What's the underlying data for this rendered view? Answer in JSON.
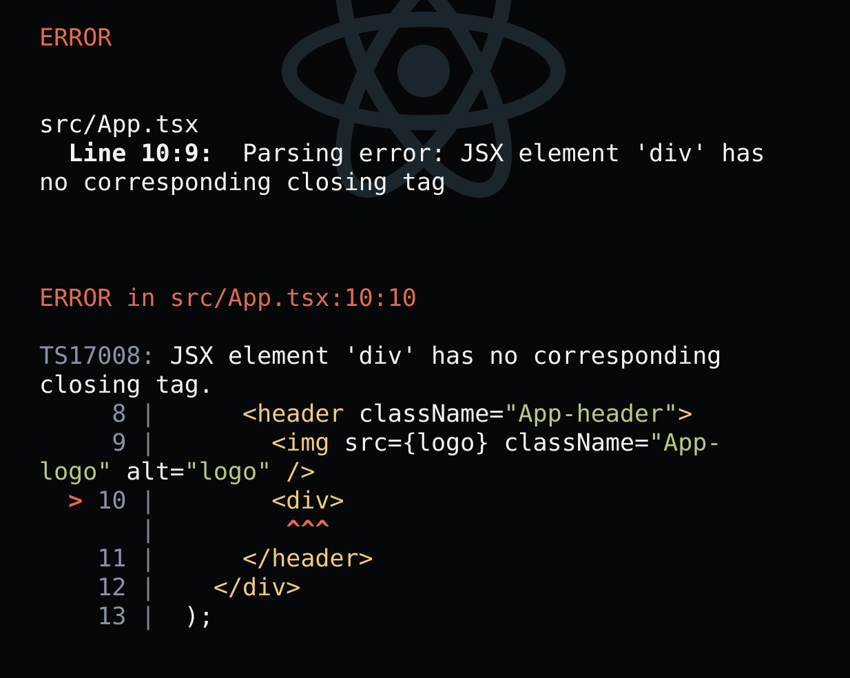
{
  "error_title": "ERROR",
  "file_path": "src/App.tsx",
  "lint": {
    "location": "Line 10:9:",
    "message": "Parsing error: JSX element 'div' has",
    "message_cont": "no corresponding closing tag"
  },
  "ts_error": {
    "header": "ERROR in src/App.tsx:10:10",
    "code": "TS17008:",
    "message": "JSX element 'div' has no corresponding",
    "message_cont": "closing tag."
  },
  "code_frame": {
    "lines": [
      {
        "num": "8",
        "marker": "",
        "indent": "      ",
        "tag_open": "<header",
        "attr": " className=",
        "str": "\"App-header\"",
        "tag_close": ">"
      },
      {
        "num": "9",
        "marker": "",
        "indent": "        ",
        "tag_open": "<img",
        "attr": " src={logo} className=",
        "str": "\"App-",
        "tag_close": ""
      },
      {
        "wrap_str": "logo\"",
        "wrap_attr": " alt=",
        "wrap_str2": "\"logo\"",
        "wrap_close": " />"
      },
      {
        "num": "10",
        "marker": ">",
        "indent": "        ",
        "tag_open": "<div>",
        "attr": "",
        "str": "",
        "tag_close": ""
      },
      {
        "caret": "^^^"
      },
      {
        "num": "11",
        "marker": "",
        "indent": "      ",
        "tag_open": "</header>",
        "attr": "",
        "str": "",
        "tag_close": ""
      },
      {
        "num": "12",
        "marker": "",
        "indent": "    ",
        "tag_open": "</div>",
        "attr": "",
        "str": "",
        "tag_close": ""
      },
      {
        "num": "13",
        "marker": "",
        "indent": "  ",
        "tag_open": "",
        "attr": ");",
        "str": "",
        "tag_close": ""
      }
    ]
  },
  "colors": {
    "error": "#e06c50",
    "gutter": "#8a94a6",
    "tag": "#f2cc7c",
    "string": "#b9c97f",
    "background": "#060708"
  },
  "background_logo": "react-logo-icon"
}
